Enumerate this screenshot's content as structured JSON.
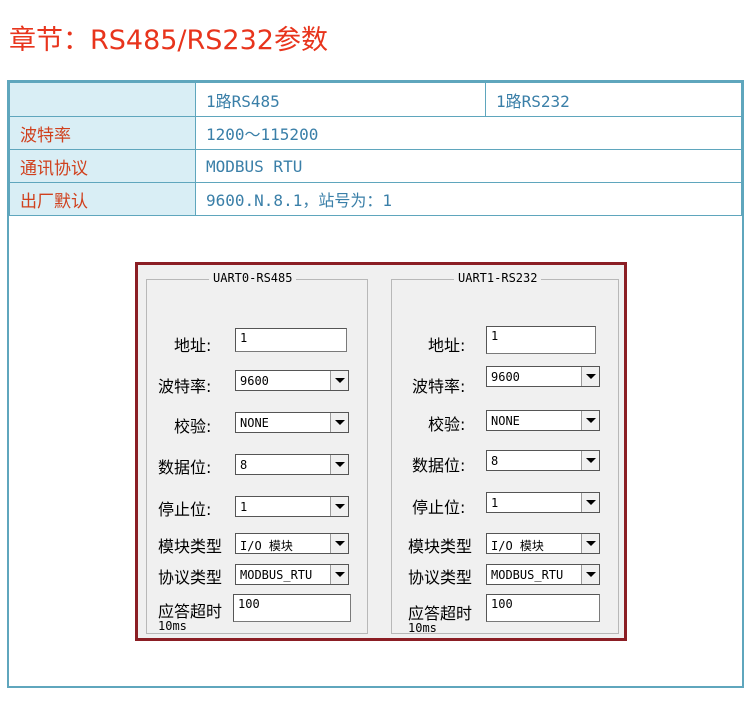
{
  "title": "章节：RS485/RS232参数",
  "table": {
    "header": [
      "",
      "1路RS485",
      "1路RS232"
    ],
    "rows": [
      {
        "label": "波特率",
        "value": "1200～115200"
      },
      {
        "label": "通讯协议",
        "value": "MODBUS RTU"
      },
      {
        "label": "出厂默认",
        "value": "9600.N.8.1，站号为：1"
      }
    ]
  },
  "dialog": {
    "groups": [
      {
        "title": "UART0-RS485",
        "address_label": "地址:",
        "address": "1",
        "baud_label": "波特率:",
        "baud": "9600",
        "parity_label": "校验:",
        "parity": "NONE",
        "databits_label": "数据位:",
        "databits": "8",
        "stopbits_label": "停止位:",
        "stopbits": "1",
        "module_label": "模块类型",
        "module": "I/O 模块",
        "protocol_label": "协议类型",
        "protocol": "MODBUS_RTU",
        "timeout_label": "应答超时",
        "timeout": "100",
        "unit": "10ms"
      },
      {
        "title": "UART1-RS232",
        "address_label": "地址:",
        "address": "1",
        "baud_label": "波特率:",
        "baud": "9600",
        "parity_label": "校验:",
        "parity": "NONE",
        "databits_label": "数据位:",
        "databits": "8",
        "stopbits_label": "停止位:",
        "stopbits": "1",
        "module_label": "模块类型",
        "module": "I/O 模块",
        "protocol_label": "协议类型",
        "protocol": "MODBUS_RTU",
        "timeout_label": "应答超时",
        "timeout": "100",
        "unit": "10ms"
      }
    ]
  },
  "colors": {
    "title": "#e8341c",
    "border": "#5fa6bd",
    "label_bg": "#d9eef5",
    "frame": "#8b1e24"
  }
}
